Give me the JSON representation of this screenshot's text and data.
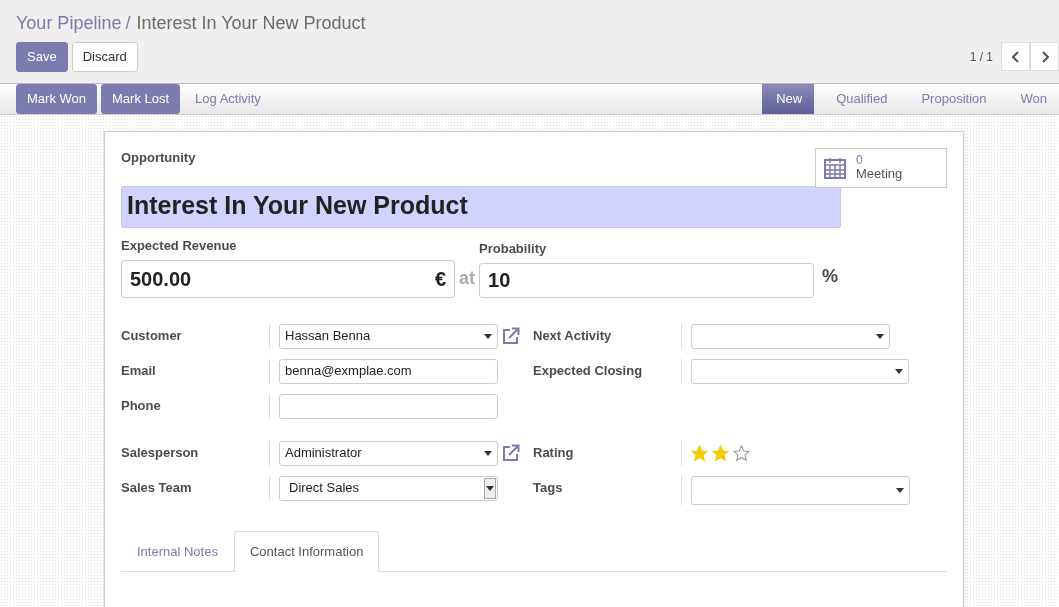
{
  "breadcrumb": {
    "parent": "Your Pipeline",
    "separator": "/",
    "current": "Interest In Your New Product"
  },
  "buttons": [
    {
      "label": "Save",
      "kind": "primary"
    },
    {
      "label": "Discard",
      "kind": "secondary"
    }
  ],
  "pager": {
    "text": "1 / 1"
  },
  "actions": [
    {
      "label": "Mark Won",
      "kind": "primary"
    },
    {
      "label": "Mark Lost",
      "kind": "primary"
    },
    {
      "label": "Log Activity",
      "kind": "link"
    }
  ],
  "stages": [
    {
      "label": "New",
      "selected": true
    },
    {
      "label": "Qualified",
      "selected": false
    },
    {
      "label": "Proposition",
      "selected": false
    },
    {
      "label": "Won",
      "selected": false
    }
  ],
  "smart_button": {
    "count": "0",
    "label": "Meeting"
  },
  "title_label": "Opportunity",
  "name": "Interest In Your New Product",
  "revenue": {
    "label": "Expected Revenue",
    "value": "500.00",
    "currency": "€"
  },
  "at": "at",
  "probability": {
    "label": "Probability",
    "value": "10",
    "unit": "%"
  },
  "groups": [
    {
      "left": [
        {
          "label": "Customer",
          "kind": "many2one",
          "value": "Hassan Benna",
          "external_link": true
        },
        {
          "label": "Email",
          "kind": "input",
          "value": "benna@exmplae.com"
        },
        {
          "label": "Phone",
          "kind": "input"
        }
      ],
      "right": [
        {
          "label": "Next Activity",
          "kind": "select"
        },
        {
          "label": "Expected Closing",
          "kind": "select"
        }
      ]
    },
    {
      "left": [
        {
          "label": "Salesperson",
          "kind": "many2one",
          "value": "Administrator",
          "external_link": true
        },
        {
          "label": "Sales Team",
          "kind": "native_select",
          "value": "Direct Sales"
        }
      ],
      "right": [
        {
          "label": "Rating",
          "kind": "stars",
          "stars": 2
        },
        {
          "label": "Tags",
          "kind": "select"
        }
      ]
    }
  ],
  "tabs": [
    {
      "label": "Internal Notes",
      "selected": false
    },
    {
      "label": "Contact Information",
      "selected": true
    }
  ]
}
